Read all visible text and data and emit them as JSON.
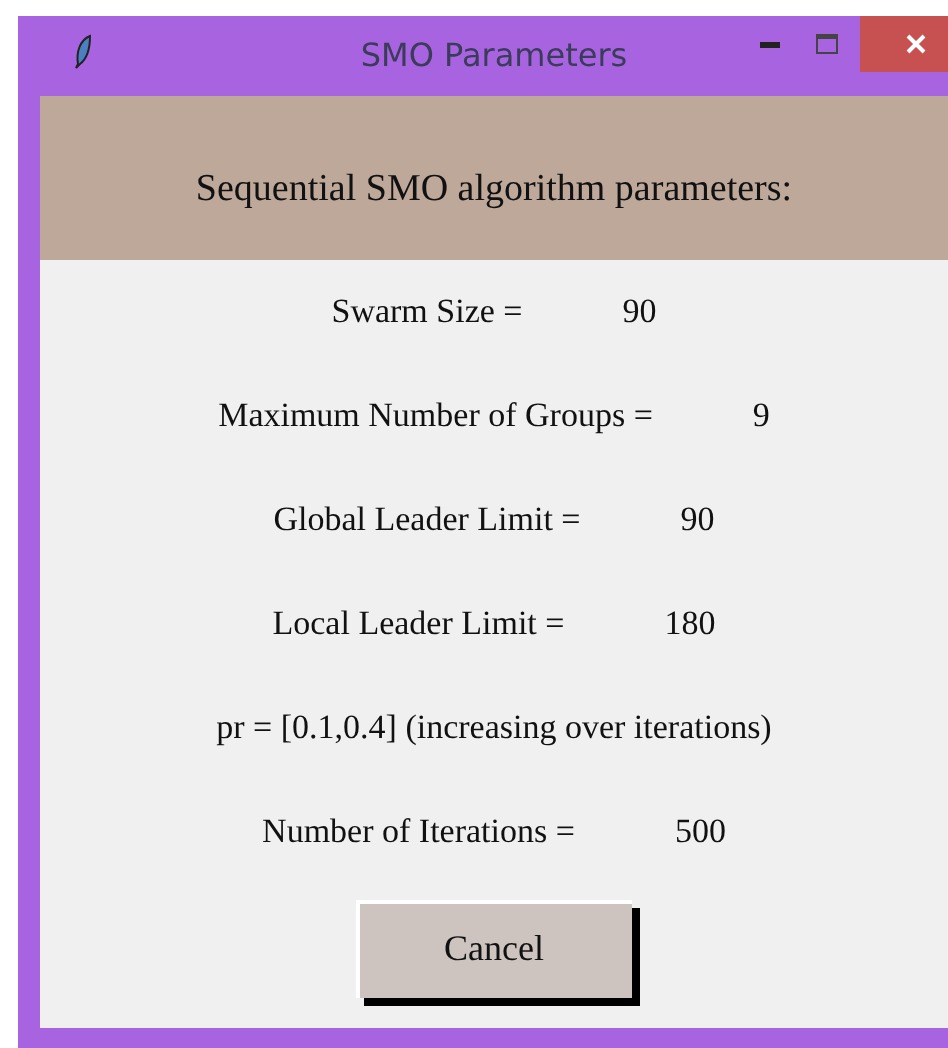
{
  "window": {
    "title": "SMO Parameters"
  },
  "header": "Sequential SMO algorithm parameters:",
  "rows": [
    {
      "kind": "pair",
      "label": "Swarm Size =",
      "value": "90"
    },
    {
      "kind": "pair",
      "label": "Maximum Number of Groups =",
      "value": "9"
    },
    {
      "kind": "pair",
      "label": "Global Leader Limit =",
      "value": "90"
    },
    {
      "kind": "pair",
      "label": "Local Leader Limit =",
      "value": "180"
    },
    {
      "kind": "text",
      "label": "pr = [0.1,0.4] (increasing over iterations)"
    },
    {
      "kind": "pair",
      "label": "Number of Iterations =",
      "value": "500"
    }
  ],
  "buttons": [
    "Cancel"
  ]
}
